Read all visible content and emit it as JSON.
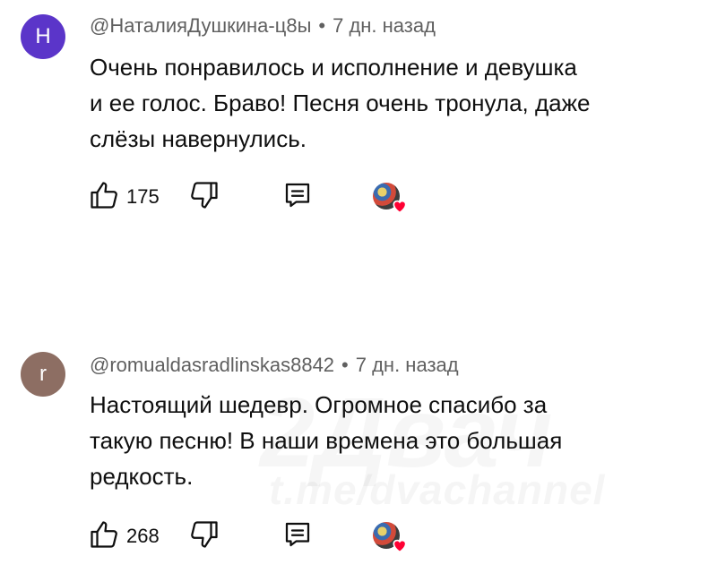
{
  "comments": [
    {
      "avatar_letter": "Н",
      "avatar_color": "#5b35c9",
      "author": "@НаталияДушкина-ц8ы",
      "time": "7 дн. назад",
      "lines": [
        "Очень понравилось и исполнение и девушка",
        "и ее голос. Браво! Песня очень тронула, даже",
        "слёзы навернулись."
      ],
      "likes": "175"
    },
    {
      "avatar_letter": "r",
      "avatar_color": "#8d6e63",
      "author": "@romualdasradlinskas8842",
      "time": "7 дн. назад",
      "lines": [
        "Настоящий шедевр. Огромное спасибо за",
        "такую песню! В наши времена это большая",
        "редкость."
      ],
      "likes": "268"
    }
  ],
  "separator": "•",
  "watermark": {
    "big": "2Двач",
    "small": "t.me/dvachannel"
  },
  "icons": {
    "like": "thumbs-up-icon",
    "dislike": "thumbs-down-icon",
    "reply": "reply-icon",
    "creator_heart": "heart-icon"
  }
}
